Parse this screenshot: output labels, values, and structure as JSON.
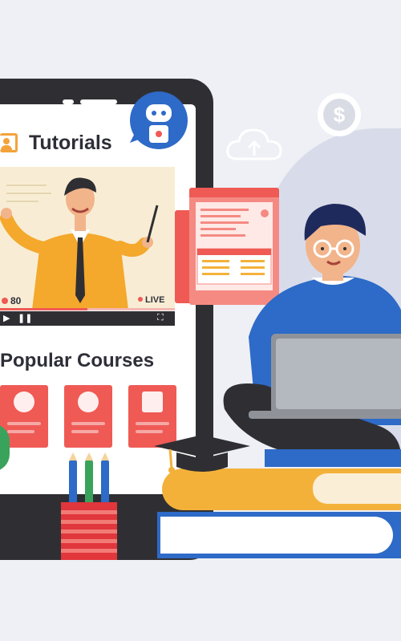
{
  "tutorials": {
    "title": "Tutorials"
  },
  "video": {
    "views": "80",
    "live_label": "LIVE",
    "progress": 0.5
  },
  "popular": {
    "title": "Popular Courses",
    "cards": [
      {
        "icon": "flask-icon"
      },
      {
        "icon": "planet-icon"
      },
      {
        "icon": "document-icon"
      }
    ]
  },
  "floating": {
    "currency_symbol": "$"
  },
  "colors": {
    "accent_red": "#ef5a55",
    "accent_orange": "#f4a23b",
    "tablet_dark": "#2f2f33",
    "blue": "#2e6ac7"
  }
}
